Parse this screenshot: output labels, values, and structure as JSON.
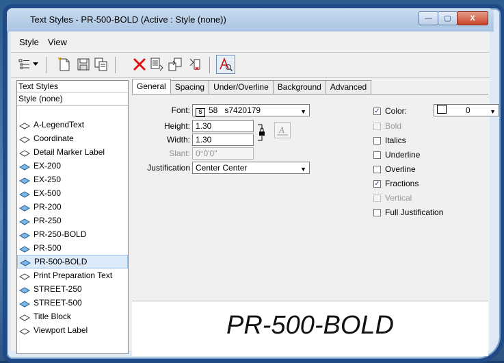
{
  "window": {
    "title": "Text Styles - PR-500-BOLD (Active : Style (none))",
    "buttons": {
      "minimize": "—",
      "maximize": "▢",
      "close": "X"
    }
  },
  "menu": {
    "style": "Style",
    "view": "View"
  },
  "toolbar": {
    "icons": [
      "list-view-icon",
      "dropdown-arrow-icon",
      "new-style-icon",
      "save-style-icon",
      "save-as-icon",
      "delete-icon",
      "rename-icon",
      "import-icon",
      "reset-icon",
      "font-preview-icon"
    ]
  },
  "left_panel": {
    "header": "Text Styles",
    "current": "Style (none)",
    "items": [
      {
        "label": "A-LegendText",
        "kind": "dgn"
      },
      {
        "label": "Coordinate",
        "kind": "dgn"
      },
      {
        "label": "Detail Marker Label",
        "kind": "dgn"
      },
      {
        "label": "EX-200",
        "kind": "lib"
      },
      {
        "label": "EX-250",
        "kind": "lib"
      },
      {
        "label": "EX-500",
        "kind": "lib"
      },
      {
        "label": "PR-200",
        "kind": "lib"
      },
      {
        "label": "PR-250",
        "kind": "lib"
      },
      {
        "label": "PR-250-BOLD",
        "kind": "lib"
      },
      {
        "label": "PR-500",
        "kind": "lib"
      },
      {
        "label": "PR-500-BOLD",
        "kind": "lib",
        "selected": true
      },
      {
        "label": "Print Preparation Text",
        "kind": "dgn"
      },
      {
        "label": "STREET-250",
        "kind": "lib"
      },
      {
        "label": "STREET-500",
        "kind": "lib"
      },
      {
        "label": "Title Block",
        "kind": "dgn"
      },
      {
        "label": "Viewport Label",
        "kind": "dgn"
      }
    ]
  },
  "tabs": [
    "General",
    "Spacing",
    "Under/Overline",
    "Background",
    "Advanced"
  ],
  "active_tab": "General",
  "general": {
    "font_label": "Font:",
    "font_num": "58",
    "font_name": "s7420179",
    "height_label": "Height:",
    "height_value": "1.30",
    "width_label": "Width:",
    "width_value": "1.30",
    "slant_label": "Slant:",
    "slant_value": "0°0'0\"",
    "justification_label": "Justification",
    "justification_value": "Center Center",
    "color_label": "Color:",
    "color_value": "0",
    "checks": [
      {
        "label": "Bold",
        "checked": false,
        "enabled": false
      },
      {
        "label": "Italics",
        "checked": false,
        "enabled": true
      },
      {
        "label": "Underline",
        "checked": false,
        "enabled": true
      },
      {
        "label": "Overline",
        "checked": false,
        "enabled": true
      },
      {
        "label": "Fractions",
        "checked": true,
        "enabled": true
      },
      {
        "label": "Vertical",
        "checked": false,
        "enabled": false
      },
      {
        "label": "Full Justification",
        "checked": false,
        "enabled": true
      }
    ],
    "color_checked": true
  },
  "preview": {
    "text": "PR-500-BOLD"
  },
  "colors": {
    "titlebar": "#a9c4e2",
    "close_button": "#c7432a",
    "selection": "#dce9f8"
  }
}
